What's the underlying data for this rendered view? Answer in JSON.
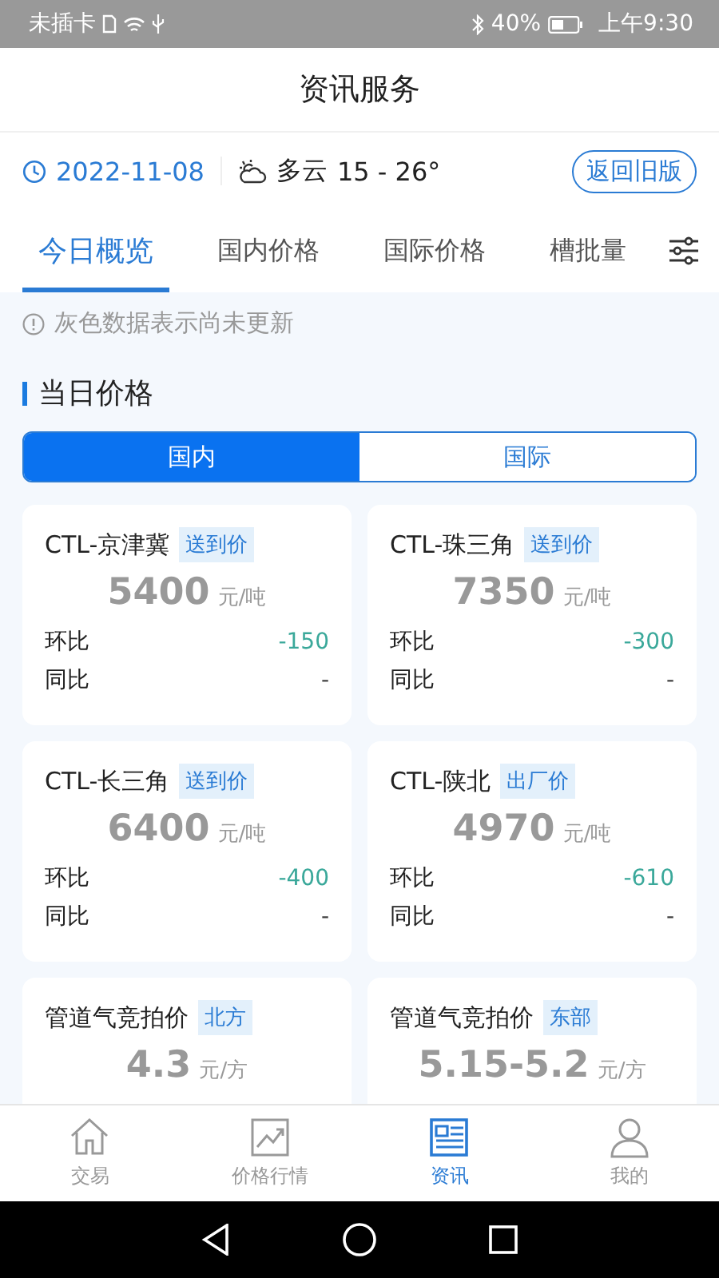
{
  "status_bar": {
    "carrier": "未插卡",
    "battery": "40%",
    "time": "上午9:30"
  },
  "header": {
    "title": "资讯服务"
  },
  "info_bar": {
    "date": "2022-11-08",
    "weather": "多云",
    "temperature": "15 - 26°",
    "old_version_button": "返回旧版"
  },
  "tabs": [
    {
      "label": "今日概览",
      "selected": true
    },
    {
      "label": "国内价格",
      "selected": false
    },
    {
      "label": "国际价格",
      "selected": false
    },
    {
      "label": "槽批量",
      "selected": false
    }
  ],
  "notice": "灰色数据表示尚未更新",
  "section_title": "当日价格",
  "segments": [
    {
      "label": "国内",
      "selected": true
    },
    {
      "label": "国际",
      "selected": false
    }
  ],
  "cards": [
    {
      "name": "CTL-京津冀",
      "tag": "送到价",
      "price": "5400",
      "unit": "元/吨",
      "updated": false,
      "rows": [
        {
          "label": "环比",
          "value": "-150",
          "kind": "down"
        },
        {
          "label": "同比",
          "value": "-",
          "kind": "none"
        }
      ]
    },
    {
      "name": "CTL-珠三角",
      "tag": "送到价",
      "price": "7350",
      "unit": "元/吨",
      "updated": false,
      "rows": [
        {
          "label": "环比",
          "value": "-300",
          "kind": "down"
        },
        {
          "label": "同比",
          "value": "-",
          "kind": "none"
        }
      ]
    },
    {
      "name": "CTL-长三角",
      "tag": "送到价",
      "price": "6400",
      "unit": "元/吨",
      "updated": false,
      "rows": [
        {
          "label": "环比",
          "value": "-400",
          "kind": "down"
        },
        {
          "label": "同比",
          "value": "-",
          "kind": "none"
        }
      ]
    },
    {
      "name": "CTL-陕北",
      "tag": "出厂价",
      "price": "4970",
      "unit": "元/吨",
      "updated": false,
      "rows": [
        {
          "label": "环比",
          "value": "-610",
          "kind": "down"
        },
        {
          "label": "同比",
          "value": "-",
          "kind": "none"
        }
      ]
    },
    {
      "name": "管道气竞拍价",
      "tag": "北方",
      "price": "4.3",
      "unit": "元/方",
      "updated": false
    },
    {
      "name": "管道气竞拍价",
      "tag": "东部",
      "price": "5.15-5.2",
      "unit": "元/方",
      "updated": false
    }
  ],
  "bottom_nav": [
    {
      "label": "交易",
      "selected": false
    },
    {
      "label": "价格行情",
      "selected": false
    },
    {
      "label": "资讯",
      "selected": true
    },
    {
      "label": "我的",
      "selected": false
    }
  ]
}
